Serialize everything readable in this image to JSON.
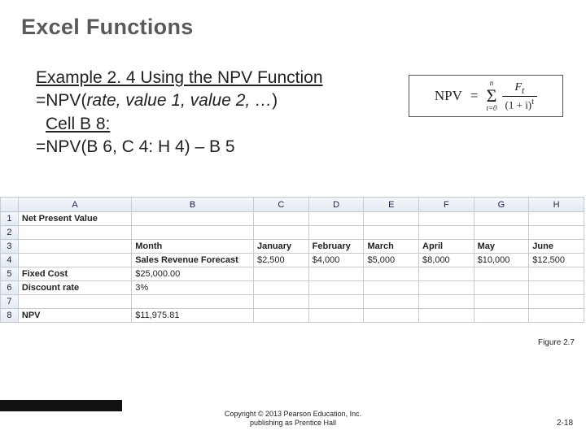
{
  "title": "Excel Functions",
  "body": {
    "line1": "Example 2. 4  Using the NPV Function",
    "line2_pre": "=NPV(",
    "line2_args": "rate, value 1, value 2, …",
    "line2_post": ")",
    "line3": "Cell B 8:",
    "line4": "=NPV(B 6, C 4: H 4) – B 5"
  },
  "formula": {
    "lhs": "NPV",
    "eq": "=",
    "sum_top": "n",
    "sum_bottom": "t=0",
    "numerator_sym": "F",
    "numerator_sub": "t",
    "denominator": "(1 + i)",
    "denominator_exp": "t"
  },
  "sheet": {
    "columns": [
      "",
      "A",
      "B",
      "C",
      "D",
      "E",
      "F",
      "G",
      "H"
    ],
    "rows": [
      {
        "n": "1",
        "A": "Net Present Value",
        "Abold": true,
        "B": "",
        "C": "",
        "D": "",
        "E": "",
        "F": "",
        "G": "",
        "H": ""
      },
      {
        "n": "2",
        "A": "",
        "B": "",
        "C": "",
        "D": "",
        "E": "",
        "F": "",
        "G": "",
        "H": ""
      },
      {
        "n": "3",
        "A": "",
        "B": "Month",
        "Bbold": true,
        "C": "January",
        "Cbold": true,
        "D": "February",
        "Dbold": true,
        "E": "March",
        "Ebold": true,
        "F": "April",
        "Fbold": true,
        "G": "May",
        "Gbold": true,
        "H": "June",
        "Hbold": true
      },
      {
        "n": "4",
        "A": "",
        "B": "Sales Revenue Forecast",
        "Bbold": true,
        "C": "$2,500",
        "D": "$4,000",
        "E": "$5,000",
        "F": "$8,000",
        "G": "$10,000",
        "H": "$12,500",
        "num": true
      },
      {
        "n": "5",
        "A": "Fixed Cost",
        "Abold": true,
        "B": "$25,000.00",
        "Bnum": true,
        "C": "",
        "D": "",
        "E": "",
        "F": "",
        "G": "",
        "H": ""
      },
      {
        "n": "6",
        "A": "Discount rate",
        "Abold": true,
        "B": "3%",
        "Bnum": true,
        "C": "",
        "D": "",
        "E": "",
        "F": "",
        "G": "",
        "H": ""
      },
      {
        "n": "7",
        "A": "",
        "B": "",
        "C": "",
        "D": "",
        "E": "",
        "F": "",
        "G": "",
        "H": ""
      },
      {
        "n": "8",
        "A": "NPV",
        "Abold": true,
        "B": "$11,975.81",
        "Bnum": true,
        "C": "",
        "D": "",
        "E": "",
        "F": "",
        "G": "",
        "H": ""
      }
    ]
  },
  "figure_caption": "Figure 2.7",
  "copyright": {
    "l1": "Copyright © 2013 Pearson Education, Inc.",
    "l2": "publishing as Prentice Hall"
  },
  "page_number": "2-18",
  "chart_data": {
    "type": "table",
    "title": "Net Present Value",
    "categories": [
      "January",
      "February",
      "March",
      "April",
      "May",
      "June"
    ],
    "series": [
      {
        "name": "Sales Revenue Forecast",
        "values": [
          2500,
          4000,
          5000,
          8000,
          10000,
          12500
        ]
      }
    ],
    "scalars": {
      "Fixed Cost": 25000.0,
      "Discount rate": 0.03,
      "NPV": 11975.81
    }
  }
}
